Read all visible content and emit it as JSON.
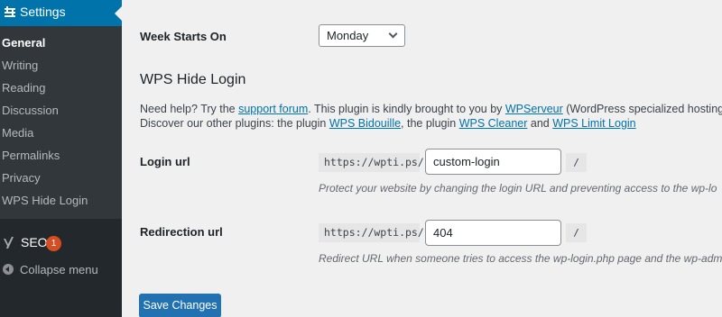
{
  "sidebar": {
    "settings_label": "Settings",
    "items": [
      {
        "label": "General",
        "current": true
      },
      {
        "label": "Writing"
      },
      {
        "label": "Reading"
      },
      {
        "label": "Discussion"
      },
      {
        "label": "Media"
      },
      {
        "label": "Permalinks"
      },
      {
        "label": "Privacy"
      },
      {
        "label": "WPS Hide Login"
      }
    ],
    "seo": {
      "label": "SEO",
      "badge": "1"
    },
    "collapse_label": "Collapse menu"
  },
  "week": {
    "label": "Week Starts On",
    "value": "Monday"
  },
  "section": {
    "title": "WPS Hide Login",
    "help1_pre": "Need help? Try the ",
    "help1_link1": "support forum",
    "help1_mid": ". This plugin is kindly brought to you by ",
    "help1_link2": "WPServeur",
    "help1_post": " (WordPress specialized hosting)",
    "help2_pre": "Discover our other plugins: the plugin ",
    "help2_link1": "WPS Bidouille",
    "help2_mid1": ", the plugin ",
    "help2_link2": "WPS Cleaner",
    "help2_mid2": " and ",
    "help2_link3": "WPS Limit Login"
  },
  "login": {
    "label": "Login url",
    "prefix": "https://wpti.ps/",
    "value": "custom-login",
    "suffix": "/",
    "desc": "Protect your website by changing the login URL and preventing access to the wp-lo"
  },
  "redirect": {
    "label": "Redirection url",
    "prefix": "https://wpti.ps/",
    "value": "404",
    "suffix": "/",
    "desc": "Redirect URL when someone tries to access the wp-login.php page and the wp-adm"
  },
  "save_label": "Save Changes",
  "colors": {
    "accent": "#0073aa",
    "sidebar": "#23282d",
    "button": "#2271b1",
    "badge": "#d54e21"
  }
}
